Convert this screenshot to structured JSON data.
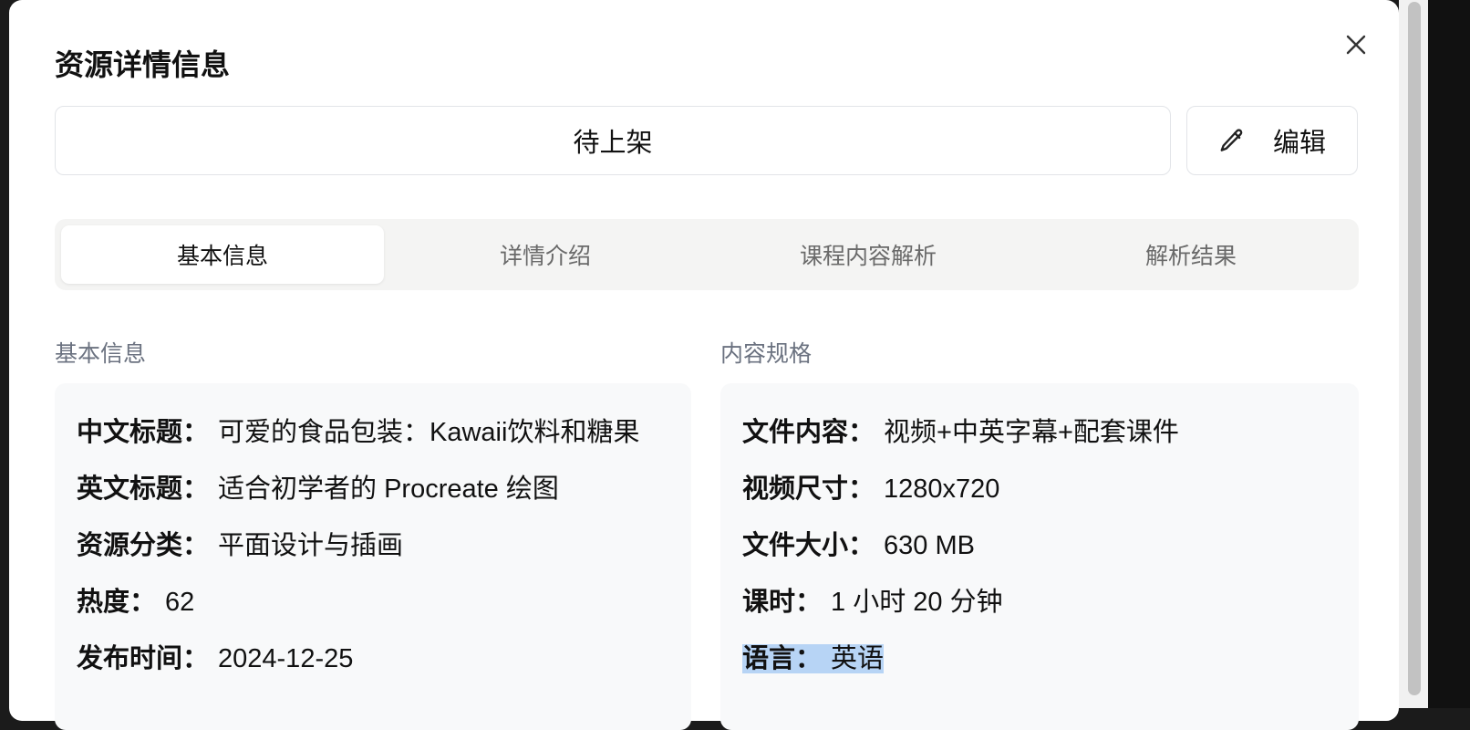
{
  "dialog": {
    "title": "资源详情信息",
    "status": "待上架",
    "edit_label": "编辑"
  },
  "tabs": [
    {
      "label": "基本信息",
      "active": true
    },
    {
      "label": "详情介绍",
      "active": false
    },
    {
      "label": "课程内容解析",
      "active": false
    },
    {
      "label": "解析结果",
      "active": false
    }
  ],
  "basic": {
    "section_title": "基本信息",
    "rows": [
      {
        "key": "中文标题：",
        "value": "可爱的食品包装：Kawaii饮料和糖果"
      },
      {
        "key": "英文标题：",
        "value": "适合初学者的 Procreate 绘图"
      },
      {
        "key": "资源分类：",
        "value": "平面设计与插画"
      },
      {
        "key": "热度：",
        "value": "62"
      },
      {
        "key": "发布时间：",
        "value": "2024-12-25"
      }
    ]
  },
  "spec": {
    "section_title": "内容规格",
    "rows": [
      {
        "key": "文件内容：",
        "value": "视频+中英字幕+配套课件"
      },
      {
        "key": "视频尺寸：",
        "value": "1280x720"
      },
      {
        "key": "文件大小：",
        "value": "630 MB"
      },
      {
        "key": "课时：",
        "value": "1 小时 20 分钟"
      },
      {
        "key": "语言：",
        "value": "英语"
      }
    ]
  },
  "colors": {
    "selection_highlight": "#b7d4f5",
    "panel_bg": "#f8f9fa",
    "tabs_bg": "#f4f4f3"
  },
  "icons": {
    "close": "close-icon",
    "edit": "pencil-icon"
  }
}
